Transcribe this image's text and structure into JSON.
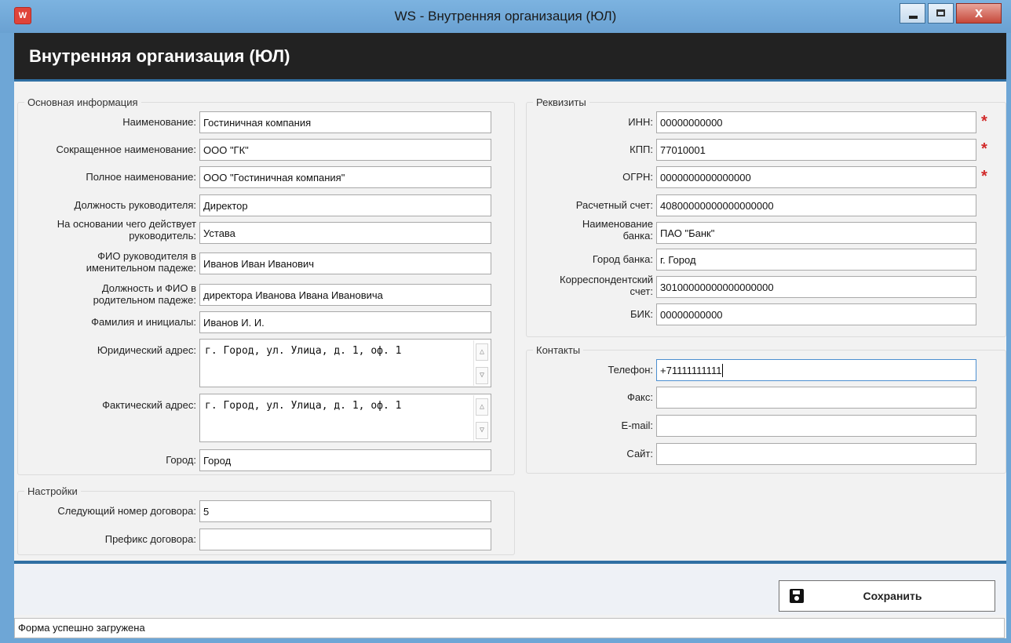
{
  "window": {
    "title": "WS - Внутренняя организация (ЮЛ)",
    "icon_letter": "W",
    "close_glyph": "x"
  },
  "header": {
    "title": "Внутренняя организация (ЮЛ)"
  },
  "main_info": {
    "group_title": "Основная информация",
    "name": {
      "label": "Наименование:",
      "value": "Гостиничная компания"
    },
    "short_name": {
      "label": "Сокращенное наименование:",
      "value": "ООО \"ГК\""
    },
    "full_name": {
      "label": "Полное наименование:",
      "value": "ООО \"Гостиничная компания\""
    },
    "director_position": {
      "label": "Должность руководителя:",
      "value": "Директор"
    },
    "basis": {
      "label_line1": "На основании чего действует",
      "label_line2": "руководитель:",
      "value": "Устава"
    },
    "director_nominative": {
      "label_line1": "ФИО руководителя в",
      "label_line2": "именительном падеже:",
      "value": "Иванов Иван Иванович"
    },
    "director_genitive": {
      "label_line1": "Должность и ФИО в",
      "label_line2": "родительном падеже:",
      "value": "директора Иванова Ивана Ивановича"
    },
    "surname_initials": {
      "label": "Фамилия и инициалы:",
      "value": "Иванов И. И."
    },
    "legal_address": {
      "label": "Юридический адрес:",
      "value": "г. Город, ул. Улица, д. 1, оф. 1"
    },
    "actual_address": {
      "label": "Фактический адрес:",
      "value": "г. Город, ул. Улица, д. 1, оф. 1"
    },
    "city": {
      "label": "Город:",
      "value": "Город"
    }
  },
  "settings": {
    "group_title": "Настройки",
    "next_contract_number": {
      "label": "Следующий номер договора:",
      "value": "5"
    },
    "contract_prefix": {
      "label": "Префикс договора:",
      "value": ""
    }
  },
  "requisites": {
    "group_title": "Реквизиты",
    "inn": {
      "label": "ИНН:",
      "value": "00000000000"
    },
    "kpp": {
      "label": "КПП:",
      "value": "77010001"
    },
    "ogrn": {
      "label": "ОГРН:",
      "value": "0000000000000000"
    },
    "account": {
      "label": "Расчетный счет:",
      "value": "40800000000000000000"
    },
    "bank_name": {
      "label_line1": "Наименование",
      "label_line2": "банка:",
      "value": "ПАО \"Банк\""
    },
    "bank_city": {
      "label": "Город банка:",
      "value": "г. Город"
    },
    "corr_account": {
      "label_line1": "Корреспондентский",
      "label_line2": "счет:",
      "value": "30100000000000000000"
    },
    "bik": {
      "label": "БИК:",
      "value": "00000000000"
    },
    "required_mark": "*"
  },
  "contacts": {
    "group_title": "Контакты",
    "phone": {
      "label": "Телефон:",
      "value": "+71111111111"
    },
    "fax": {
      "label": "Факс:",
      "value": ""
    },
    "email": {
      "label": "E-mail:",
      "value": ""
    },
    "site": {
      "label": "Сайт:",
      "value": ""
    }
  },
  "footer": {
    "save_label": "Сохранить"
  },
  "status_bar": {
    "text": "Форма успешно загружена"
  },
  "colors": {
    "accent": "#2f6fa3",
    "header_bg": "#222222",
    "required": "#d12a2a"
  }
}
